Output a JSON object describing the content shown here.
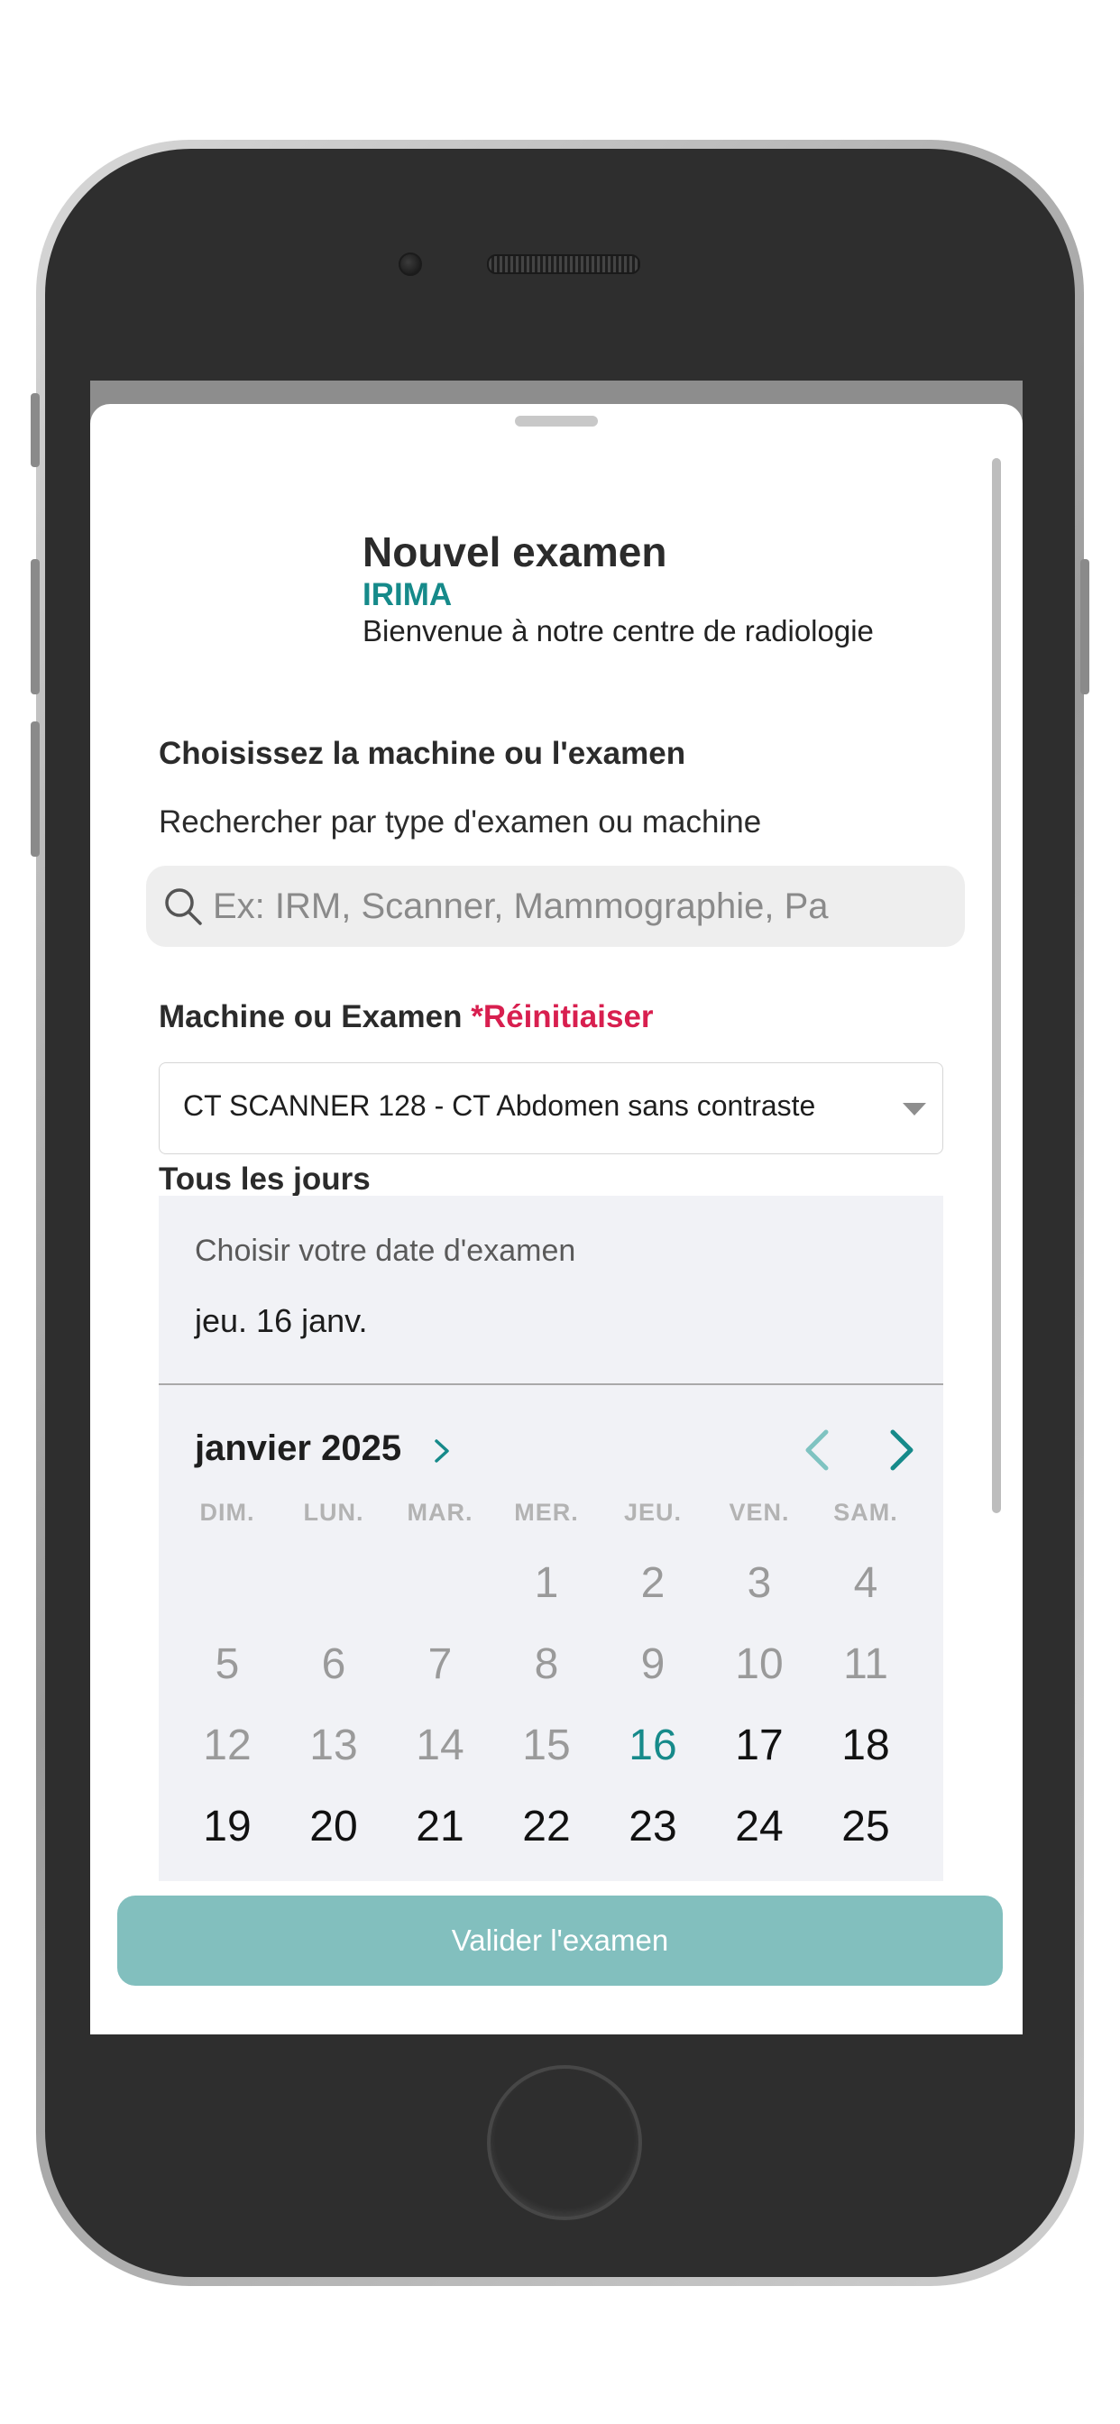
{
  "header": {
    "title": "Nouvel examen",
    "brand": "IRIMA",
    "welcome": "Bienvenue à notre centre de radiologie"
  },
  "selection": {
    "title": "Choisissez la machine ou l'examen",
    "subtitle": "Rechercher par type d'examen ou machine",
    "search_placeholder": "Ex: IRM, Scanner, Mammographie, Pa"
  },
  "machine": {
    "label": "Machine ou Examen",
    "reset_label": "*Réinitiaiser",
    "selected": "CT SCANNER 128 - CT Abdomen sans contraste"
  },
  "schedule": {
    "frequency_label": "Tous les jours",
    "date_label": "Choisir votre date d'examen",
    "date_value": "jeu. 16 janv."
  },
  "calendar": {
    "month_year": "janvier 2025",
    "weekdays": [
      "DIM.",
      "LUN.",
      "MAR.",
      "MER.",
      "JEU.",
      "VEN.",
      "SAM."
    ],
    "weeks": [
      [
        null,
        null,
        null,
        1,
        2,
        3,
        4
      ],
      [
        5,
        6,
        7,
        8,
        9,
        10,
        11
      ],
      [
        12,
        13,
        14,
        15,
        16,
        17,
        18
      ],
      [
        19,
        20,
        21,
        22,
        23,
        24,
        25
      ]
    ],
    "selected_day": 16,
    "first_available_day": 16,
    "icons": {
      "prev": "chevron-left-icon",
      "next": "chevron-right-icon",
      "month_expand": "chevron-right-icon"
    }
  },
  "actions": {
    "submit_label": "Valider l'examen"
  },
  "colors": {
    "brand": "#168a8a",
    "accent_reset": "#d81f4f",
    "submit_bg": "#82bfbe"
  }
}
